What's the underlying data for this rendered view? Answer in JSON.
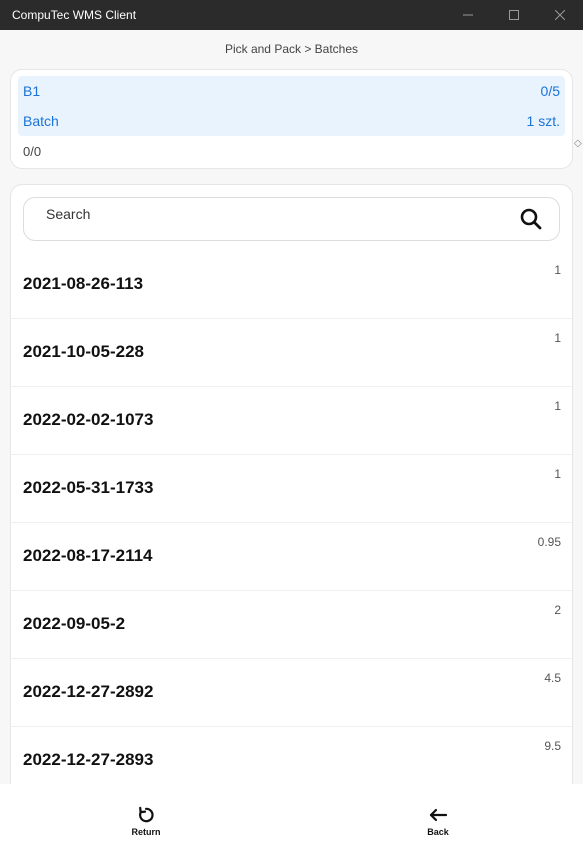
{
  "window": {
    "title": "CompuTec WMS Client"
  },
  "breadcrumb": "Pick and Pack > Batches",
  "summary": {
    "item_code": "B1",
    "item_progress": "0/5",
    "type_label": "Batch",
    "quantity": "1 szt.",
    "batch_progress": "0/0"
  },
  "search": {
    "placeholder": "Search"
  },
  "batches": [
    {
      "name": "2021-08-26-113",
      "qty": "1"
    },
    {
      "name": "2021-10-05-228",
      "qty": "1"
    },
    {
      "name": "2022-02-02-1073",
      "qty": "1"
    },
    {
      "name": "2022-05-31-1733",
      "qty": "1"
    },
    {
      "name": "2022-08-17-2114",
      "qty": "0.95"
    },
    {
      "name": "2022-09-05-2",
      "qty": "2"
    },
    {
      "name": "2022-12-27-2892",
      "qty": "4.5"
    },
    {
      "name": "2022-12-27-2893",
      "qty": "9.5"
    }
  ],
  "footer": {
    "return_label": "Return",
    "back_label": "Back"
  },
  "colors": {
    "accent": "#1a73d9",
    "highlight_bg": "#e9f3fd",
    "titlebar_bg": "#2b2b2b"
  },
  "icons": [
    "minimize-icon",
    "maximize-icon",
    "close-icon",
    "search-icon",
    "refresh-icon",
    "arrow-left-icon"
  ]
}
